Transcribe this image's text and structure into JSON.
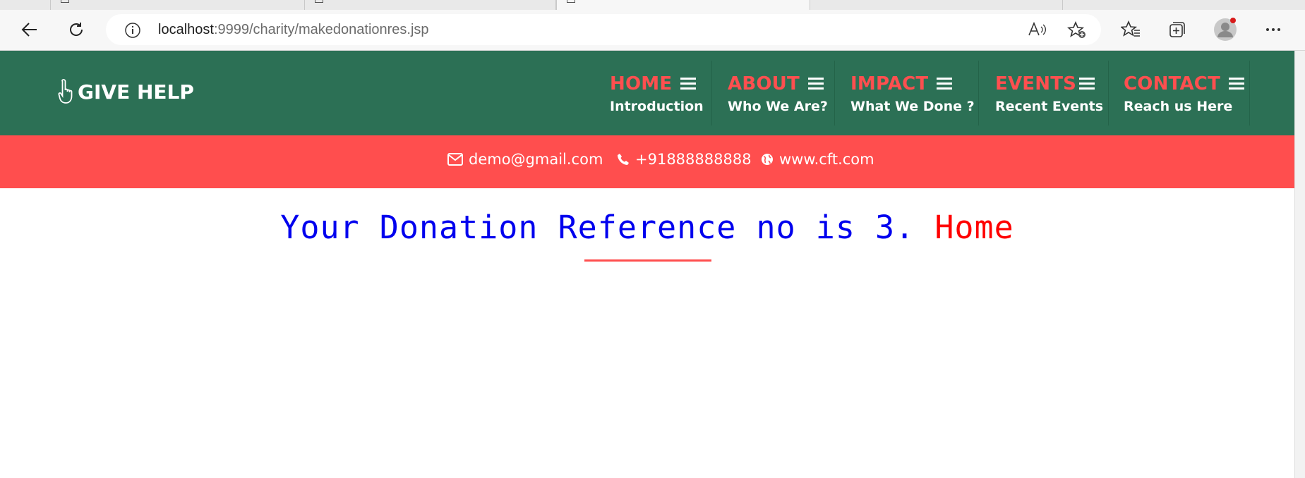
{
  "browser": {
    "url_host": "localhost",
    "url_path": ":9999/charity/makedonationres.jsp"
  },
  "site": {
    "logo_text": "GIVE HELP",
    "nav": [
      {
        "title": "HOME",
        "subtitle": "Introduction"
      },
      {
        "title": "ABOUT",
        "subtitle": "Who We Are?"
      },
      {
        "title": "IMPACT",
        "subtitle": "What We Done ?"
      },
      {
        "title": "EVENTS",
        "subtitle": "Recent Events"
      },
      {
        "title": "CONTACT",
        "subtitle": "Reach us Here"
      }
    ],
    "contact": {
      "email": "demo@gmail.com",
      "phone": "+91888888888",
      "website": "www.cft.com"
    }
  },
  "main": {
    "message": "Your Donation Reference no is 3.",
    "home_link": "Home"
  },
  "colors": {
    "header_bg": "#2c7055",
    "accent_red": "#ff4e4e",
    "message_blue": "#0000ee",
    "link_red": "#ff0000"
  }
}
